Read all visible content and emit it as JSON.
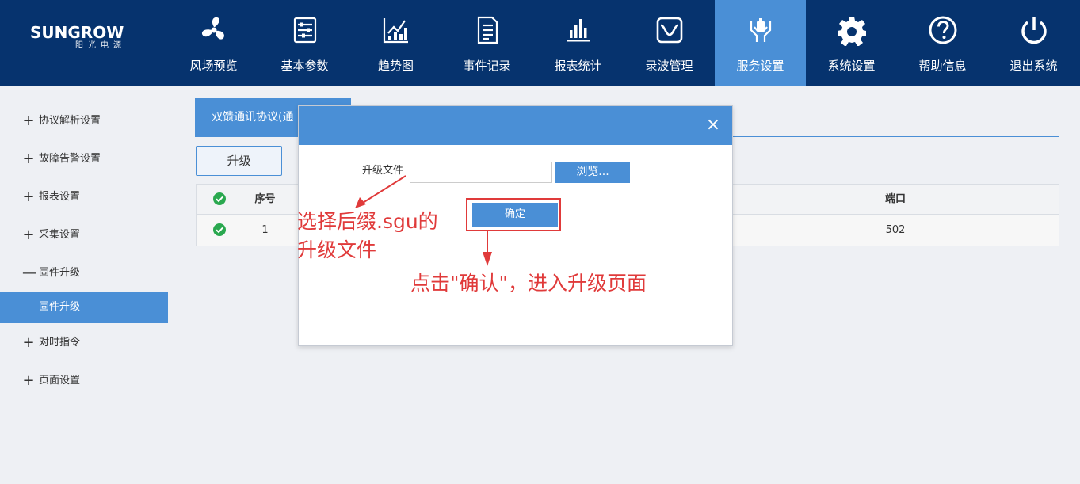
{
  "brand": {
    "name": "SUNGROW",
    "sub": "阳光电源"
  },
  "nav": [
    {
      "label": "风场预览",
      "icon": "fan-icon"
    },
    {
      "label": "基本参数",
      "icon": "sliders-icon"
    },
    {
      "label": "趋势图",
      "icon": "chart-icon"
    },
    {
      "label": "事件记录",
      "icon": "document-icon"
    },
    {
      "label": "报表统计",
      "icon": "bars-icon"
    },
    {
      "label": "录波管理",
      "icon": "waveform-icon"
    },
    {
      "label": "服务设置",
      "icon": "hands-icon",
      "active": true
    },
    {
      "label": "系统设置",
      "icon": "gear-icon"
    },
    {
      "label": "帮助信息",
      "icon": "help-icon"
    },
    {
      "label": "退出系统",
      "icon": "power-icon"
    }
  ],
  "sidebar": {
    "items": [
      {
        "sign": "+",
        "label": "协议解析设置"
      },
      {
        "sign": "+",
        "label": "故障告警设置"
      },
      {
        "sign": "+",
        "label": "报表设置"
      },
      {
        "sign": "+",
        "label": "采集设置"
      },
      {
        "sign": "—",
        "label": "固件升级"
      },
      {
        "sign": "+",
        "label": "对时指令"
      },
      {
        "sign": "+",
        "label": "页面设置"
      }
    ],
    "active_sub": "固件升级"
  },
  "main": {
    "tab_label": "双馈通讯协议(通",
    "upgrade_button": "升级",
    "table": {
      "headers": [
        "",
        "序号",
        "",
        "端口"
      ],
      "rows": [
        {
          "no": "1",
          "port": "502"
        }
      ]
    }
  },
  "modal": {
    "file_label": "升级文件",
    "file_value": "",
    "browse_button": "浏览...",
    "confirm_button": "确定",
    "close": "×"
  },
  "annotations": {
    "suffix_line1": "选择后缀.sgu的",
    "suffix_line2": "升级文件",
    "confirm_hint": "点击\"确认\"，进入升级页面"
  },
  "colors": {
    "topbar": "#06336e",
    "accent": "#4a8fd6",
    "annotation": "#e03a3a",
    "check": "#2aa84f"
  }
}
